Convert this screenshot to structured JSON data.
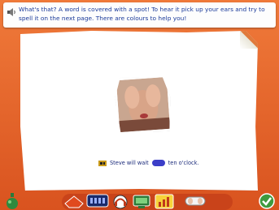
{
  "instruction": {
    "text": "What's that? A word is covered with a spot! To hear it pick up your ears and try to spell it on the next page. There are colours to help you!",
    "icon": "speaker-icon"
  },
  "exercise": {
    "sentence_before": "Steve will wait",
    "sentence_after": "ten o'clock.",
    "hidden_word_icon": "paint-spot",
    "spot_color": "#3b3ec8",
    "photo": "child-covering-eyes-photo"
  },
  "toolbar": {
    "buttons": [
      {
        "name": "potion-bottle-icon"
      },
      {
        "name": "home-arrow-icon"
      },
      {
        "name": "clock-display-icon"
      },
      {
        "name": "headphones-icon"
      },
      {
        "name": "computer-icon"
      },
      {
        "name": "bar-chart-icon"
      },
      {
        "name": "ears-icon"
      },
      {
        "name": "check-icon"
      }
    ],
    "accent": "#e8642c"
  }
}
